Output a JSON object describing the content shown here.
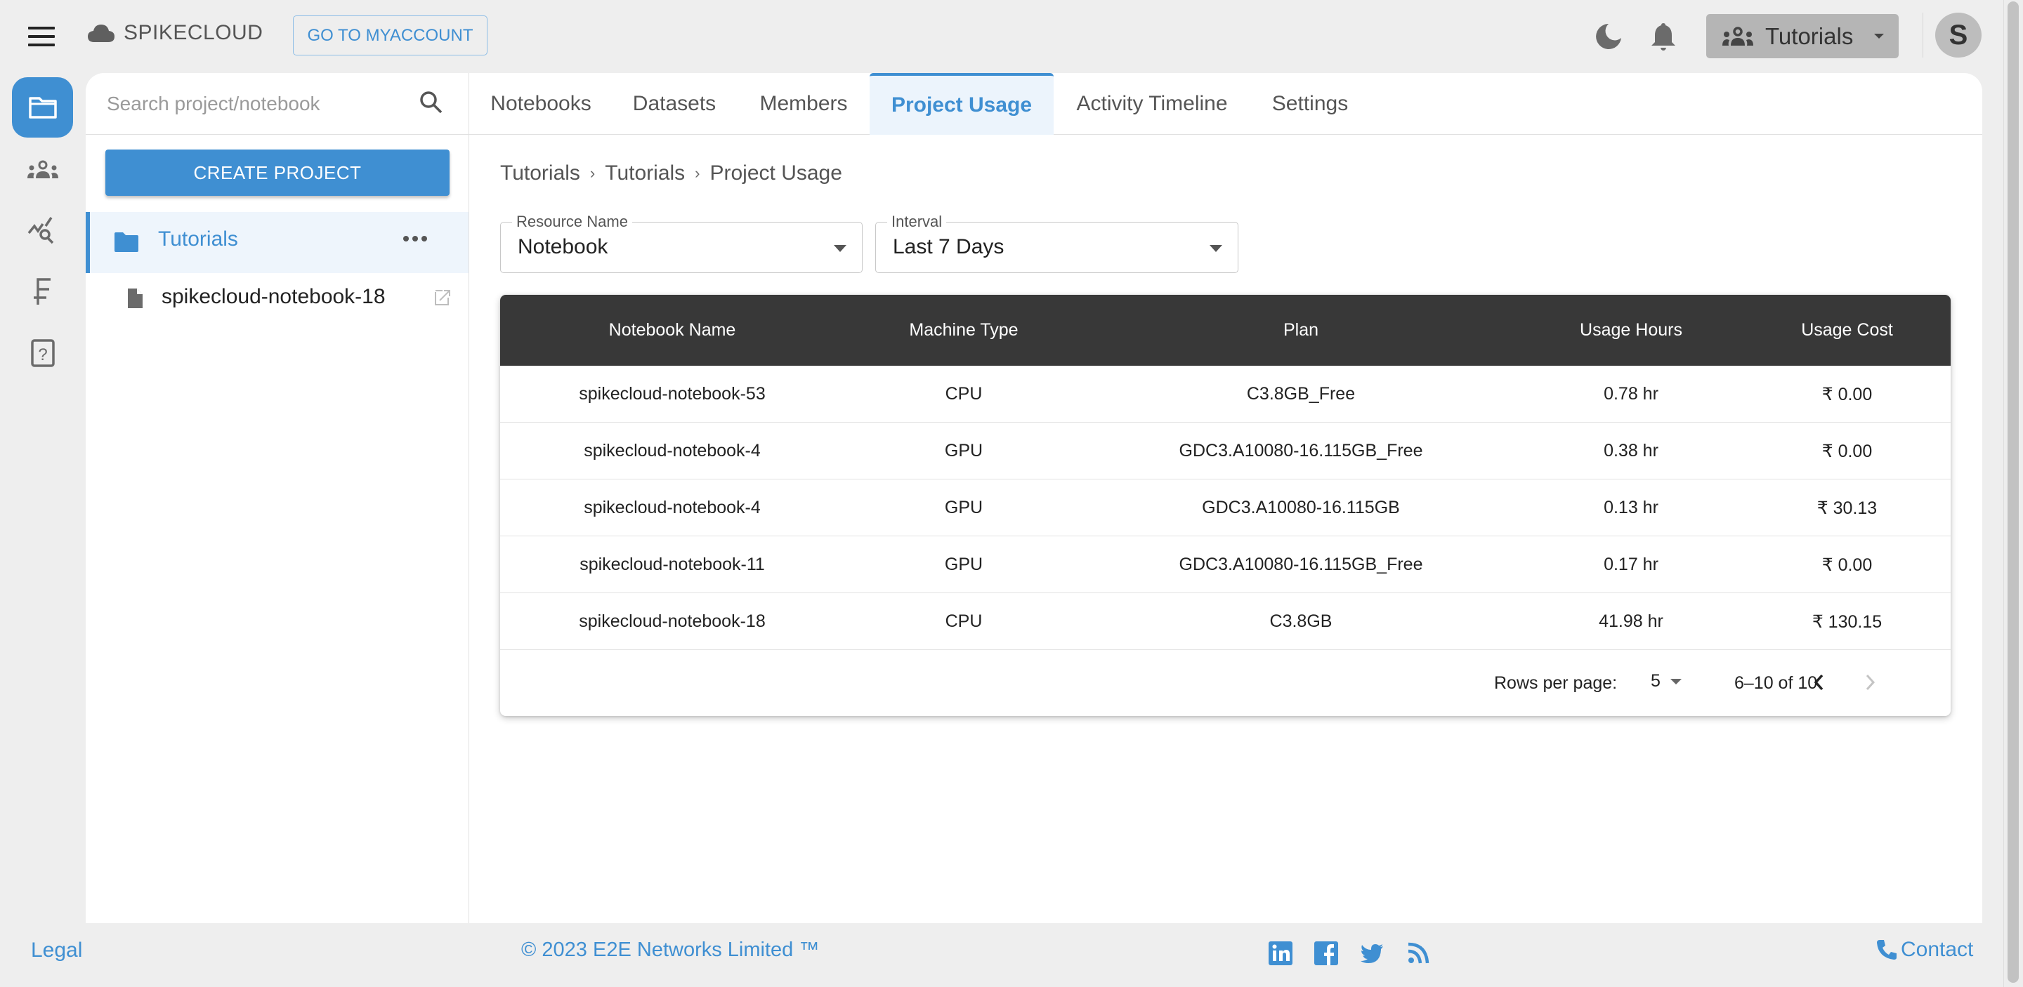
{
  "app": {
    "brand": "SPIKECLOUD",
    "myaccount_label": "GO TO MYACCOUNT",
    "project_switcher_label": "Tutorials",
    "avatar_initial": "S"
  },
  "colors": {
    "accent": "#3f8fd2",
    "table_header_bg": "#383838",
    "active_tab_bg": "#ecf4fc"
  },
  "rail": {
    "items": [
      {
        "icon": "folder-icon",
        "active": true
      },
      {
        "icon": "people-icon",
        "active": false
      },
      {
        "icon": "analytics-search-icon",
        "active": false
      },
      {
        "icon": "currency-icon",
        "active": false
      },
      {
        "icon": "help-icon",
        "active": false
      }
    ]
  },
  "left_panel": {
    "search_placeholder": "Search project/notebook",
    "create_label": "CREATE PROJECT",
    "project": {
      "label": "Tutorials"
    },
    "notebooks": [
      {
        "label": "spikecloud-notebook-18"
      }
    ]
  },
  "tabs": [
    {
      "label": "Notebooks",
      "active": false
    },
    {
      "label": "Datasets",
      "active": false
    },
    {
      "label": "Members",
      "active": false
    },
    {
      "label": "Project Usage",
      "active": true
    },
    {
      "label": "Activity Timeline",
      "active": false
    },
    {
      "label": "Settings",
      "active": false
    }
  ],
  "breadcrumb": [
    "Tutorials",
    "Tutorials",
    "Project Usage"
  ],
  "breadcrumb_sep": "›",
  "filters": {
    "resource": {
      "label": "Resource Name",
      "value": "Notebook"
    },
    "interval": {
      "label": "Interval",
      "value": "Last 7 Days"
    }
  },
  "table": {
    "columns": [
      "Notebook Name",
      "Machine Type",
      "Plan",
      "Usage Hours",
      "Usage Cost"
    ],
    "rows": [
      [
        "spikecloud-notebook-53",
        "CPU",
        "C3.8GB_Free",
        "0.78 hr",
        "₹ 0.00"
      ],
      [
        "spikecloud-notebook-4",
        "GPU",
        "GDC3.A10080-16.115GB_Free",
        "0.38 hr",
        "₹ 0.00"
      ],
      [
        "spikecloud-notebook-4",
        "GPU",
        "GDC3.A10080-16.115GB",
        "0.13 hr",
        "₹ 30.13"
      ],
      [
        "spikecloud-notebook-11",
        "GPU",
        "GDC3.A10080-16.115GB_Free",
        "0.17 hr",
        "₹ 0.00"
      ],
      [
        "spikecloud-notebook-18",
        "CPU",
        "C3.8GB",
        "41.98 hr",
        "₹ 130.15"
      ]
    ],
    "pagination": {
      "rows_per_page_label": "Rows per page:",
      "rows_per_page": "5",
      "range": "6–10 of 10",
      "prev_enabled": true,
      "next_enabled": false
    }
  },
  "footer": {
    "legal": "Legal",
    "copyright": "© 2023 E2E Networks Limited ™",
    "social": [
      "linkedin-icon",
      "facebook-icon",
      "twitter-icon",
      "rss-icon"
    ],
    "contact": "Contact"
  }
}
